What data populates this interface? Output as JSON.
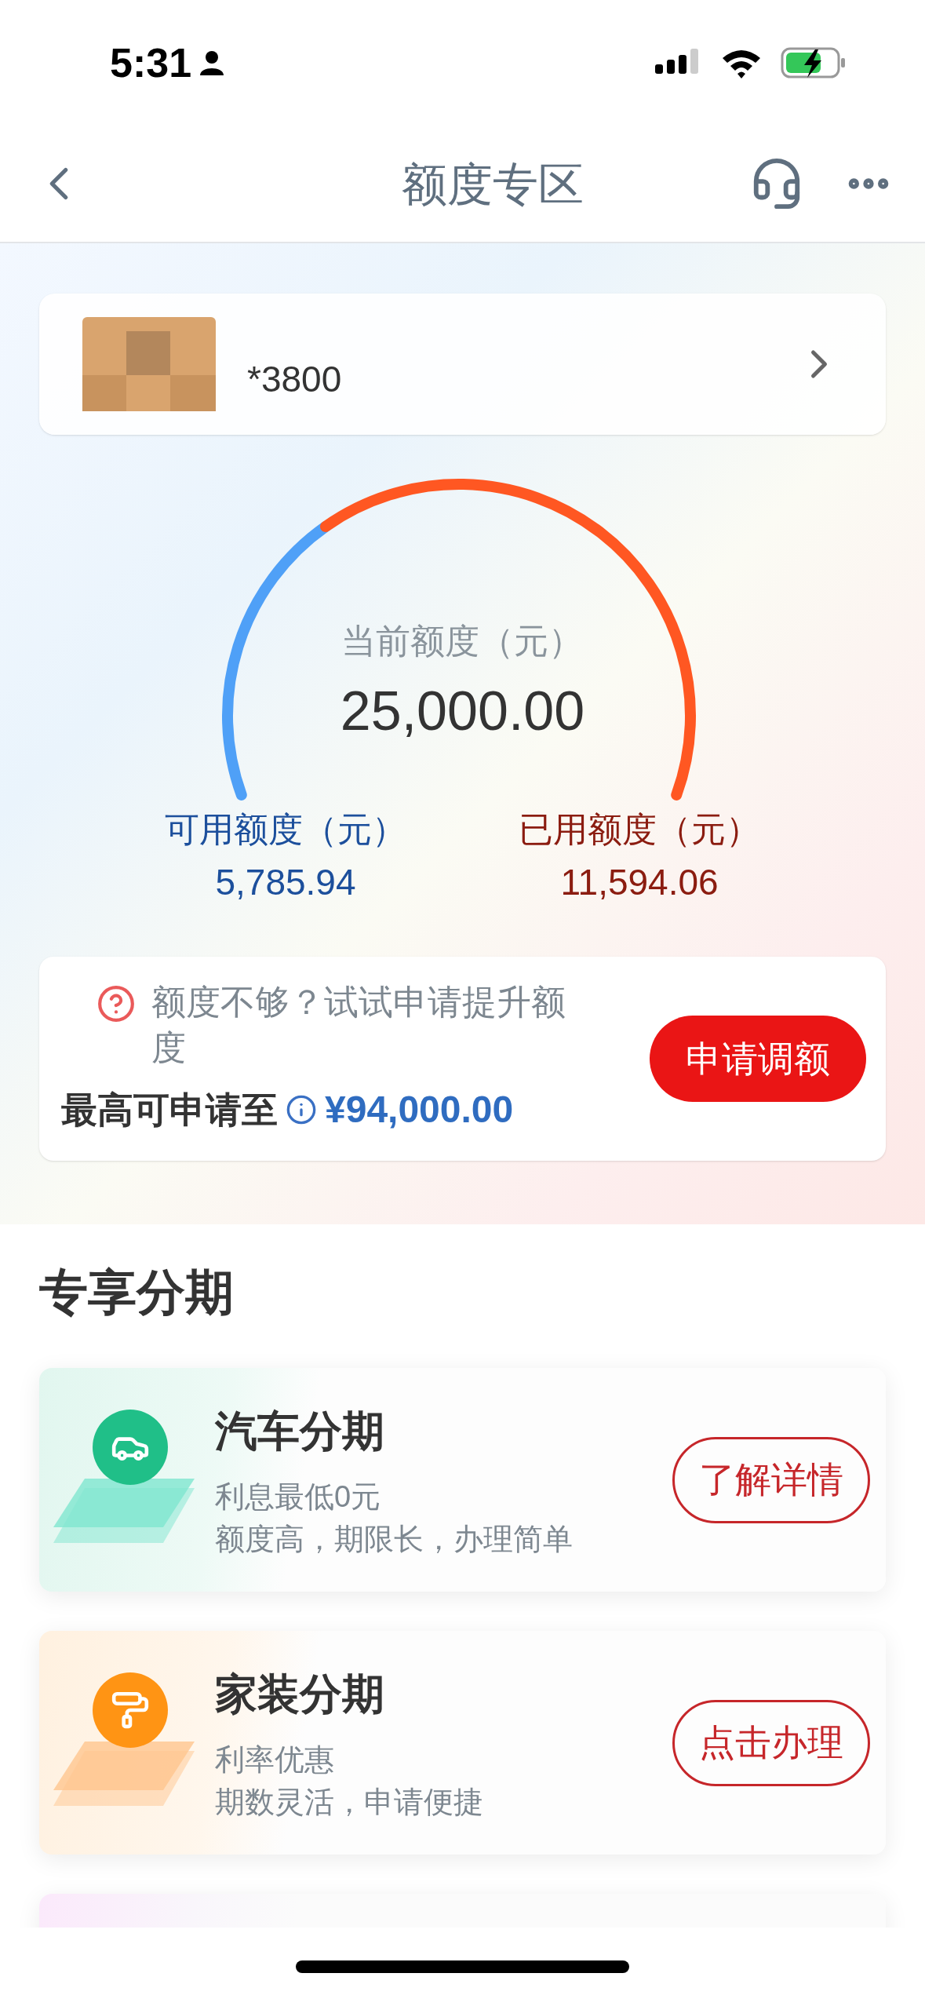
{
  "status_bar": {
    "time": "5:31"
  },
  "header": {
    "title": "额度专区"
  },
  "account": {
    "card_number": "*3800"
  },
  "gauge": {
    "title": "当前额度（元）",
    "total": "25,000.00"
  },
  "available": {
    "label": "可用额度（元）",
    "value": "5,785.94"
  },
  "used": {
    "label": "已用额度（元）",
    "value": "11,594.06"
  },
  "raise": {
    "question": "额度不够？试试申请提升额度",
    "max_label": "最高可申请至",
    "max_value": "¥94,000.00",
    "button": "申请调额"
  },
  "section": {
    "title": "专享分期"
  },
  "items": [
    {
      "kind": "car",
      "color": "#20bf88",
      "title": "汽车分期",
      "lines": [
        "利息最低0元",
        "额度高，期限长，办理简单"
      ],
      "button": "了解详情"
    },
    {
      "kind": "decor",
      "color": "#ff9414",
      "title": "家装分期",
      "lines": [
        "利率优惠",
        "期数灵活，申请便捷"
      ],
      "button": "点击办理"
    }
  ]
}
